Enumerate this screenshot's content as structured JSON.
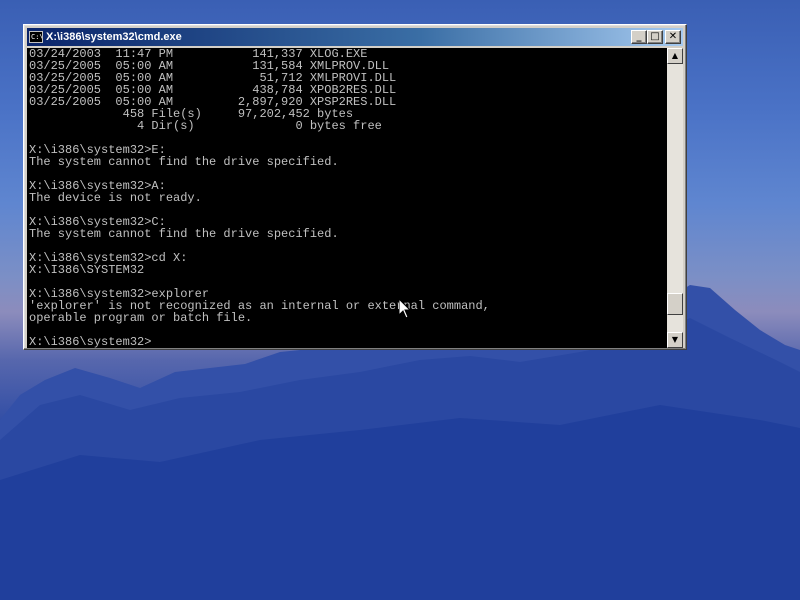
{
  "window": {
    "title": "X:\\i386\\system32\\cmd.exe",
    "icon_text": "C:\\",
    "buttons": {
      "minimize": "_",
      "maximize": "□",
      "close": "✕"
    }
  },
  "console": {
    "lines": [
      "03/24/2003  11:47 PM           141,337 XLOG.EXE",
      "03/25/2005  05:00 AM           131,584 XMLPROV.DLL",
      "03/25/2005  05:00 AM            51,712 XMLPROVI.DLL",
      "03/25/2005  05:00 AM           438,784 XPOB2RES.DLL",
      "03/25/2005  05:00 AM         2,897,920 XPSP2RES.DLL",
      "             458 File(s)     97,202,452 bytes",
      "               4 Dir(s)              0 bytes free",
      "",
      "X:\\i386\\system32>E:",
      "The system cannot find the drive specified.",
      "",
      "X:\\i386\\system32>A:",
      "The device is not ready.",
      "",
      "X:\\i386\\system32>C:",
      "The system cannot find the drive specified.",
      "",
      "X:\\i386\\system32>cd X:",
      "X:\\I386\\SYSTEM32",
      "",
      "X:\\i386\\system32>explorer",
      "'explorer' is not recognized as an internal or external command,",
      "operable program or batch file.",
      "",
      "X:\\i386\\system32>"
    ],
    "text_color": "#c0c0c0",
    "background_color": "#000000"
  },
  "scrollbar": {
    "up_arrow": "▲",
    "down_arrow": "▼",
    "thumb_position": 0.93
  },
  "colors": {
    "titlebar_start": "#0a246a",
    "titlebar_end": "#a6caf0",
    "window_face": "#d4d0c8"
  },
  "icons": [
    "console-app-icon",
    "minimize-icon",
    "maximize-icon",
    "close-icon",
    "scroll-up-icon",
    "scroll-down-icon",
    "mouse-pointer-icon"
  ]
}
